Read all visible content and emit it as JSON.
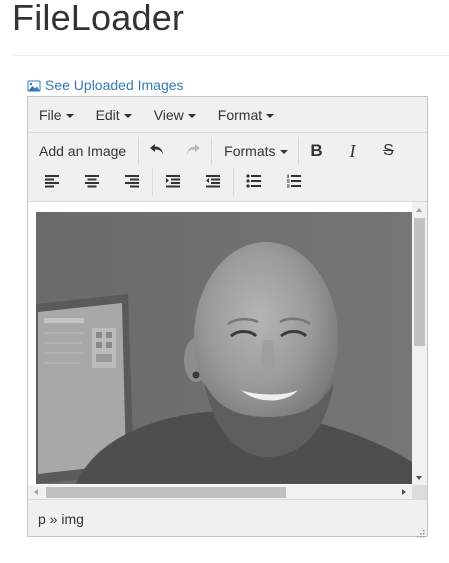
{
  "page": {
    "title": "FileLoader"
  },
  "uploaded_link": {
    "label": "See Uploaded Images",
    "icon": "picture-icon",
    "color": "#337ab7"
  },
  "editor": {
    "menubar": [
      {
        "label": "File"
      },
      {
        "label": "Edit"
      },
      {
        "label": "View"
      },
      {
        "label": "Format"
      }
    ],
    "toolbar": {
      "add_image_label": "Add an Image",
      "formats_label": "Formats",
      "bold_label": "B",
      "italic_label": "I",
      "strike_label": "S",
      "icons": [
        "undo-icon",
        "redo-icon",
        "align-left-icon",
        "align-center-icon",
        "align-right-icon",
        "indent-icon",
        "outdent-icon",
        "bullet-list-icon",
        "numbered-list-icon"
      ]
    },
    "content": {
      "image_subject": "portrait-photo",
      "image_tint": "grayscale"
    },
    "statusbar": {
      "path": "p » img"
    }
  }
}
